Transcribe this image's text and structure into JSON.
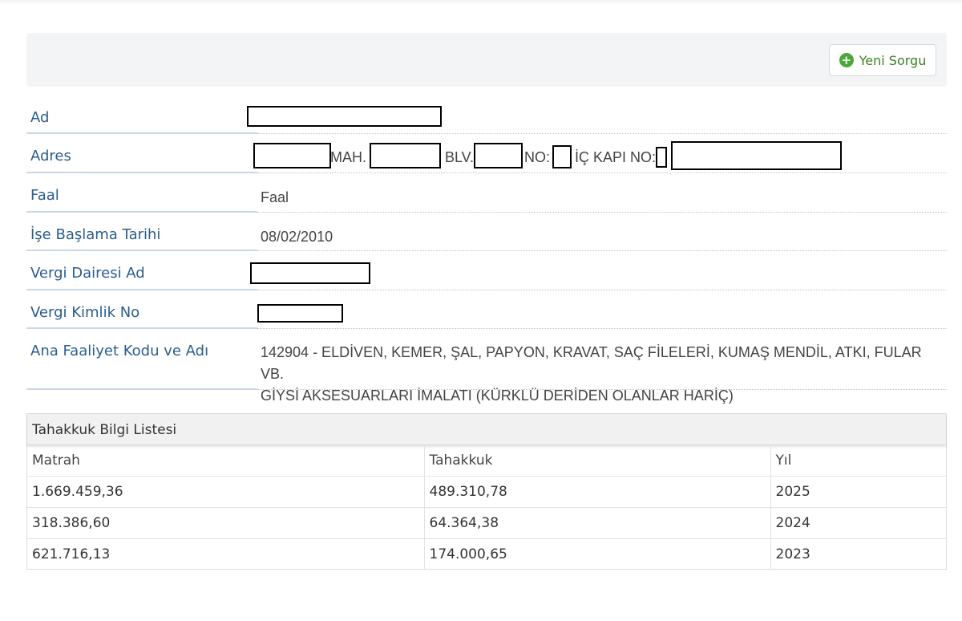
{
  "toolbar": {
    "new_query_label": "Yeni Sorgu"
  },
  "info": {
    "ad_label": "Ad",
    "adres_label": "Adres",
    "adres_mah": "MAH.",
    "adres_blv": "BLV.",
    "adres_no": "NO:",
    "adres_ickapi": "İÇ KAPI NO:",
    "faal_label": "Faal",
    "faal_value": "Faal",
    "ise_baslama_label": "İşe Başlama Tarihi",
    "ise_baslama_value": "08/02/2010",
    "vergi_dairesi_label": "Vergi Dairesi Ad",
    "vergi_kimlik_label": "Vergi Kimlik No",
    "faaliyet_label": "Ana Faaliyet Kodu ve Adı",
    "faaliyet_value_line1": "142904 - ELDİVEN, KEMER, ŞAL, PAPYON, KRAVAT, SAÇ FİLELERİ, KUMAŞ MENDİL, ATKI, FULAR VB.",
    "faaliyet_value_line2": "GİYSİ AKSESUARLARI İMALATI (KÜRKLÜ DERİDEN OLANLAR HARİÇ)"
  },
  "tahakkuk": {
    "title": "Tahakkuk Bilgi Listesi",
    "columns": [
      "Matrah",
      "Tahakkuk",
      "Yıl"
    ],
    "rows": [
      [
        "1.669.459,36",
        "489.310,78",
        "2025"
      ],
      [
        "318.386,60",
        "64.364,38",
        "2024"
      ],
      [
        "621.716,13",
        "174.000,65",
        "2023"
      ]
    ]
  },
  "colors": {
    "label_blue": "#2a5d8f",
    "accent_green": "#4aa83a"
  },
  "icons": {
    "new_query": "plus-circle-icon"
  }
}
